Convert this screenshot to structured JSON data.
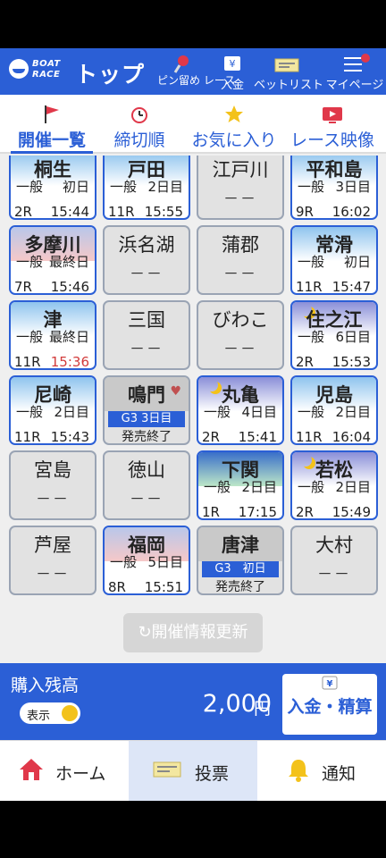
{
  "header": {
    "logo_line1": "BOAT",
    "logo_line2": "RACE",
    "title": "トップ",
    "pin_label": "ピン留め レース",
    "deposit_label": "入金",
    "betlist_label": "ベットリスト",
    "mypage_label": "マイページ"
  },
  "tabs": [
    {
      "label": "開催一覧"
    },
    {
      "label": "締切順"
    },
    {
      "label": "お気に入り"
    },
    {
      "label": "レース映像"
    }
  ],
  "venues": [
    {
      "name": "桐生",
      "grade": "一般",
      "day": "初日",
      "race": "2R",
      "time": "15:44",
      "status": "active",
      "sky": "day"
    },
    {
      "name": "戸田",
      "grade": "一般",
      "day": "2日目",
      "race": "11R",
      "time": "15:55",
      "status": "active",
      "sky": "day"
    },
    {
      "name": "江戸川",
      "dash": "－－",
      "status": "inactive"
    },
    {
      "name": "平和島",
      "grade": "一般",
      "day": "3日目",
      "race": "9R",
      "time": "16:02",
      "status": "active",
      "sky": "day"
    },
    {
      "name": "多摩川",
      "grade": "一般",
      "day": "最終日",
      "race": "7R",
      "time": "15:46",
      "status": "active",
      "sky": "sunset"
    },
    {
      "name": "浜名湖",
      "dash": "－－",
      "status": "inactive"
    },
    {
      "name": "蒲郡",
      "dash": "－－",
      "status": "inactive"
    },
    {
      "name": "常滑",
      "grade": "一般",
      "day": "初日",
      "race": "11R",
      "time": "15:47",
      "status": "active",
      "sky": "day"
    },
    {
      "name": "津",
      "grade": "一般",
      "day": "最終日",
      "race": "11R",
      "time": "15:36",
      "status": "active",
      "sky": "day",
      "time_alert": true
    },
    {
      "name": "三国",
      "dash": "－－",
      "status": "inactive"
    },
    {
      "name": "びわこ",
      "dash": "－－",
      "status": "inactive"
    },
    {
      "name": "住之江",
      "grade": "一般",
      "day": "6日目",
      "race": "2R",
      "time": "15:53",
      "status": "active",
      "sky": "night"
    },
    {
      "name": "尼崎",
      "grade": "一般",
      "day": "2日目",
      "race": "11R",
      "time": "15:43",
      "status": "active",
      "sky": "day"
    },
    {
      "name": "鳴門",
      "g3": "G3 3日目",
      "end": "発売終了",
      "status": "g3",
      "favorite": true
    },
    {
      "name": "丸亀",
      "grade": "一般",
      "day": "4日目",
      "race": "2R",
      "time": "15:41",
      "status": "active",
      "sky": "night"
    },
    {
      "name": "児島",
      "grade": "一般",
      "day": "2日目",
      "race": "11R",
      "time": "16:04",
      "status": "active",
      "sky": "day"
    },
    {
      "name": "宮島",
      "dash": "－－",
      "status": "inactive"
    },
    {
      "name": "徳山",
      "dash": "－－",
      "status": "inactive"
    },
    {
      "name": "下関",
      "grade": "一般",
      "day": "2日目",
      "race": "1R",
      "time": "17:15",
      "status": "active",
      "sky": "nightgreen"
    },
    {
      "name": "若松",
      "grade": "一般",
      "day": "2日目",
      "race": "2R",
      "time": "15:49",
      "status": "active",
      "sky": "night"
    },
    {
      "name": "芦屋",
      "dash": "－－",
      "status": "inactive"
    },
    {
      "name": "福岡",
      "grade": "一般",
      "day": "5日目",
      "race": "8R",
      "time": "15:51",
      "status": "active",
      "sky": "sunset"
    },
    {
      "name": "唐津",
      "g3": "G3　初日",
      "end": "発売終了",
      "status": "g3"
    },
    {
      "name": "大村",
      "dash": "－－",
      "status": "inactive"
    }
  ],
  "refresh_label": "開催情報更新",
  "balance": {
    "label": "購入残高",
    "toggle_label": "表示",
    "amount": "2,000",
    "unit": "円",
    "deposit_settle_label": "入金・精算"
  },
  "bottom_nav": [
    {
      "label": "ホーム"
    },
    {
      "label": "投票"
    },
    {
      "label": "通知"
    }
  ],
  "colors": {
    "brand": "#2b5fd6",
    "alert": "#d23b3b"
  }
}
